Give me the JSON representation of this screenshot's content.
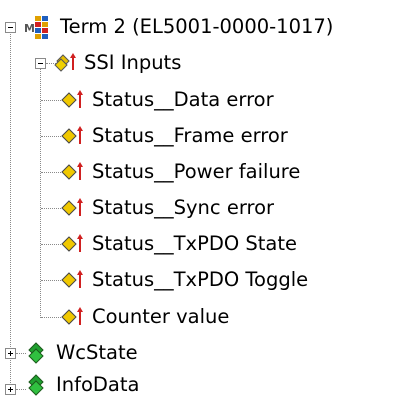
{
  "tree": {
    "root": {
      "label": "Term 2 (EL5001-0000-1017)",
      "icon": "terminal-module-icon",
      "expanded": true
    },
    "group": {
      "label": "SSI Inputs",
      "icon": "input-group-icon",
      "expanded": true
    },
    "vars": [
      {
        "label": "Status__Data error",
        "icon": "input-variable-icon"
      },
      {
        "label": "Status__Frame error",
        "icon": "input-variable-icon"
      },
      {
        "label": "Status__Power failure",
        "icon": "input-variable-icon"
      },
      {
        "label": "Status__Sync error",
        "icon": "input-variable-icon"
      },
      {
        "label": "Status__TxPDO State",
        "icon": "input-variable-icon"
      },
      {
        "label": "Status__TxPDO Toggle",
        "icon": "input-variable-icon"
      },
      {
        "label": "Counter value",
        "icon": "input-variable-icon"
      }
    ],
    "collapsed": [
      {
        "label": "WcState",
        "icon": "green-variable-group-icon",
        "expanded": false
      },
      {
        "label": "InfoData",
        "icon": "green-variable-group-icon",
        "expanded": false
      }
    ]
  }
}
